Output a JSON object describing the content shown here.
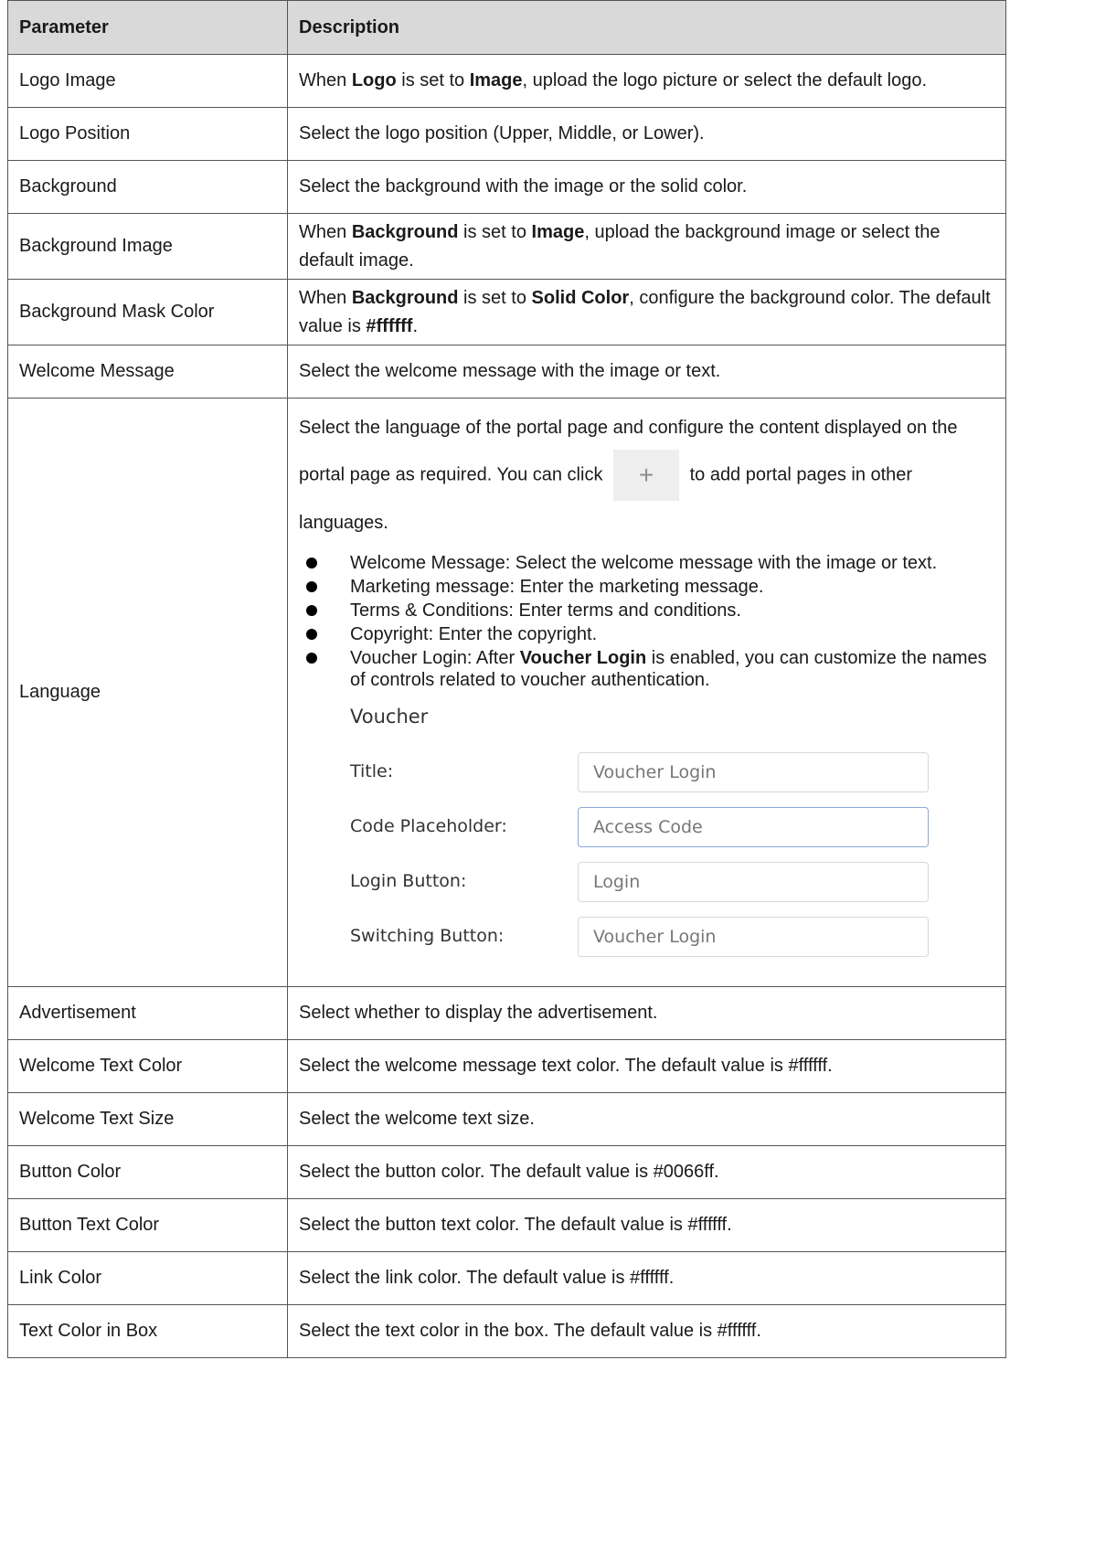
{
  "table": {
    "headers": [
      "Parameter",
      "Description"
    ],
    "rows": [
      {
        "param": "Logo Image",
        "desc": [
          [
            "When ",
            false
          ],
          [
            "Logo",
            true
          ],
          [
            " is set to ",
            false
          ],
          [
            "Image",
            true
          ],
          [
            ", upload the logo picture or select the default logo.",
            false
          ]
        ]
      },
      {
        "param": "Logo Position",
        "desc": [
          [
            "Select the logo position (Upper, Middle, or Lower).",
            false
          ]
        ]
      },
      {
        "param": "Background",
        "desc": [
          [
            "Select the background with the image or the solid color.",
            false
          ]
        ]
      },
      {
        "param": "Background Image",
        "desc": [
          [
            "When ",
            false
          ],
          [
            "Background",
            true
          ],
          [
            " is set to ",
            false
          ],
          [
            "Image",
            true
          ],
          [
            ", upload the background image or select the default image.",
            false
          ]
        ]
      },
      {
        "param": "Background Mask Color",
        "desc": [
          [
            "When ",
            false
          ],
          [
            "Background",
            true
          ],
          [
            " is set to ",
            false
          ],
          [
            "Solid Color",
            true
          ],
          [
            ", configure the background color. The default value is ",
            false
          ],
          [
            "#ffffff",
            true
          ],
          [
            ".",
            false
          ]
        ]
      },
      {
        "param": "Welcome Message",
        "desc": [
          [
            "Select the welcome message with the image or text.",
            false
          ]
        ]
      },
      {
        "param": "Language",
        "language": true
      },
      {
        "param": "Advertisement",
        "desc": [
          [
            "Select whether to display the advertisement.",
            false
          ]
        ]
      },
      {
        "param": "Welcome Text Color",
        "desc": [
          [
            "Select the welcome message text color. The default value is #ffffff.",
            false
          ]
        ]
      },
      {
        "param": "Welcome Text Size",
        "desc": [
          [
            "Select the welcome text size.",
            false
          ]
        ]
      },
      {
        "param": "Button Color",
        "desc": [
          [
            "Select the button color. The default value is #0066ff.",
            false
          ]
        ]
      },
      {
        "param": "Button Text Color",
        "desc": [
          [
            "Select the button text color. The default value is #ffffff.",
            false
          ]
        ]
      },
      {
        "param": "Link Color",
        "desc": [
          [
            "Select the link color. The default value is #ffffff.",
            false
          ]
        ]
      },
      {
        "param": "Text Color in Box",
        "desc": [
          [
            "Select the text color in the box. The default value is #ffffff.",
            false
          ]
        ]
      }
    ]
  },
  "language": {
    "intro_before": "Select the language of the portal page and configure the content displayed on the portal page as required. You can click",
    "plus_icon": "plus-icon",
    "plus_glyph": "+",
    "intro_after": "to add portal pages in other languages.",
    "bullets": [
      [
        [
          "Welcome Message: Select the welcome message with the image or text.",
          false
        ]
      ],
      [
        [
          "Marketing message: Enter the marketing message.",
          false
        ]
      ],
      [
        [
          "Terms & Conditions: Enter terms and conditions.",
          false
        ]
      ],
      [
        [
          "Copyright: Enter the copyright.",
          false
        ]
      ],
      [
        [
          "Voucher Login: After ",
          false
        ],
        [
          "Voucher Login",
          true
        ],
        [
          " is enabled, you can customize the names of controls related to voucher authentication.",
          false
        ]
      ]
    ],
    "voucher": {
      "title": "Voucher",
      "fields": [
        {
          "label": "Title:",
          "value": "Voucher Login",
          "focused": false
        },
        {
          "label": "Code Placeholder:",
          "value": "Access Code",
          "focused": true
        },
        {
          "label": "Login Button:",
          "value": "Login",
          "focused": false
        },
        {
          "label": "Switching Button:",
          "value": "Voucher Login",
          "focused": false
        }
      ]
    }
  }
}
